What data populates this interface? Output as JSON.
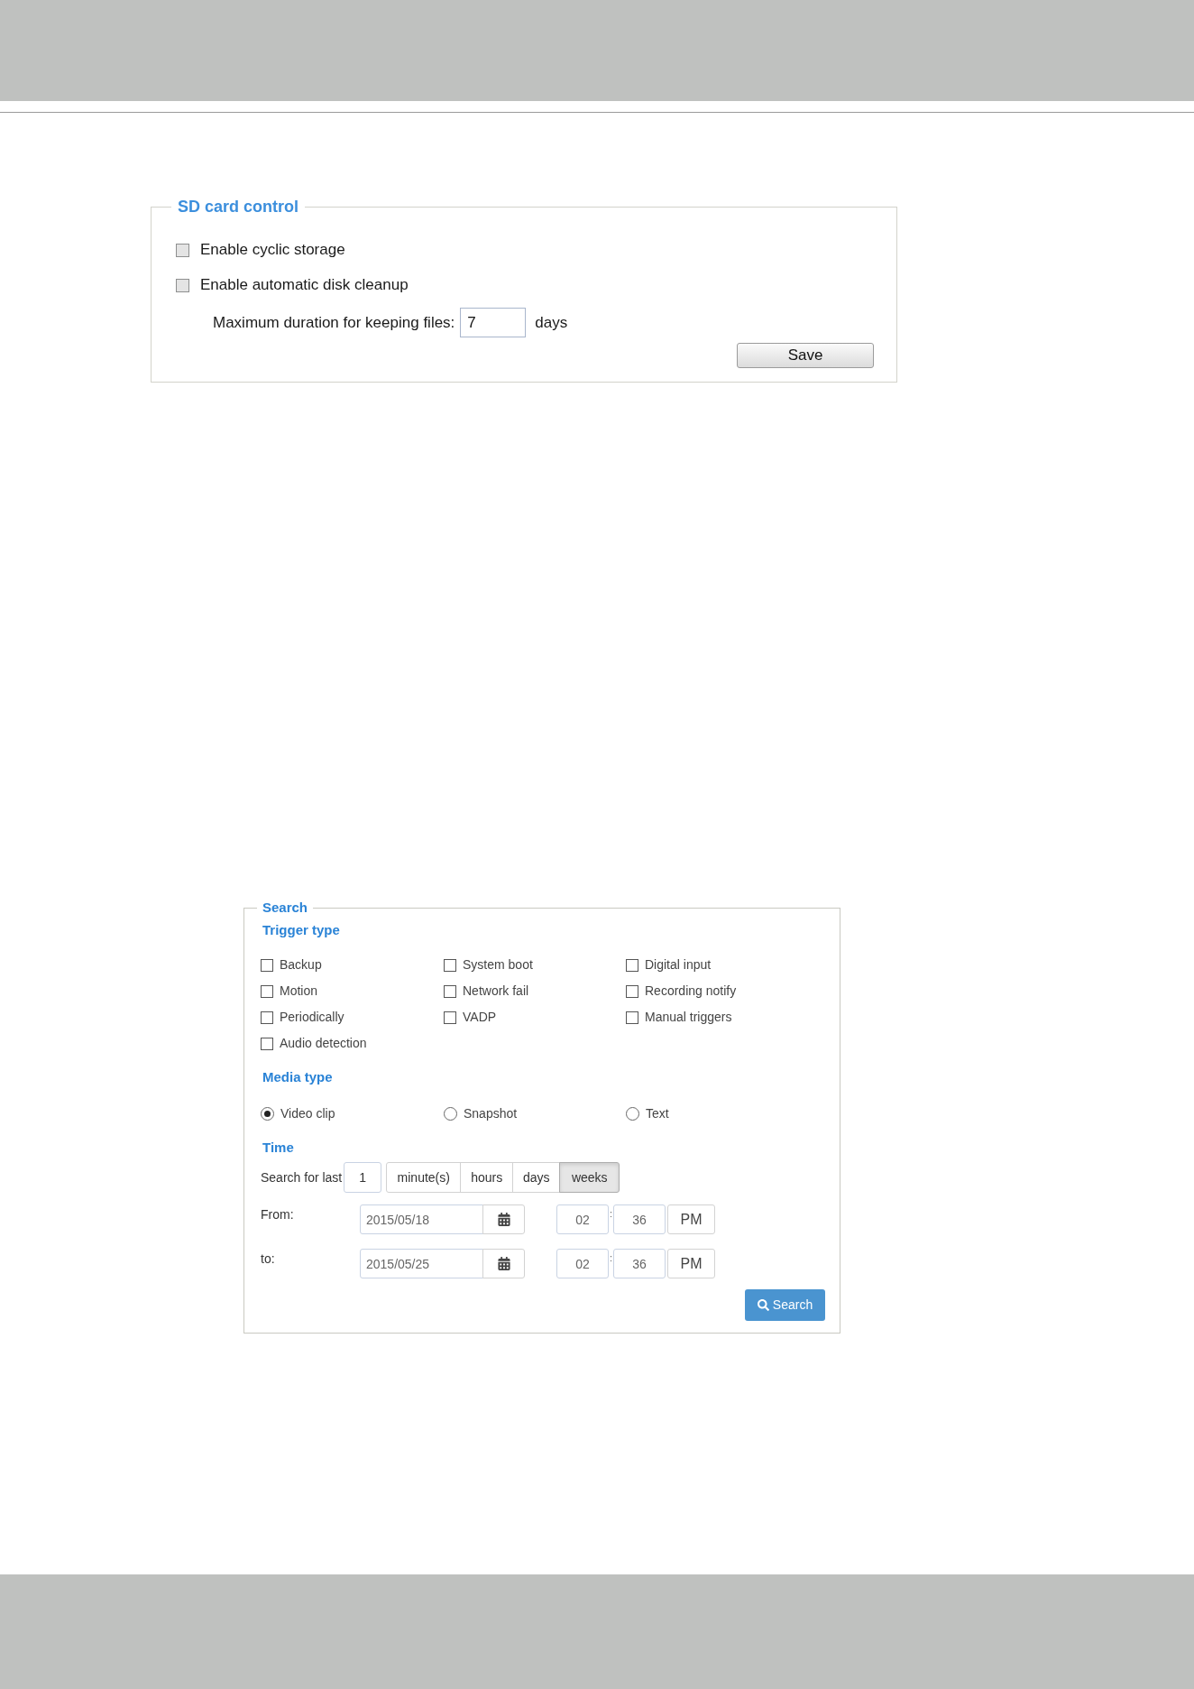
{
  "sd_card_control": {
    "title": "SD card control",
    "options": [
      {
        "label": "Enable cyclic storage",
        "checked": false
      },
      {
        "label": "Enable automatic disk cleanup",
        "checked": false
      }
    ],
    "max_duration": {
      "label": "Maximum duration for keeping files:",
      "value": "7",
      "unit": "days"
    },
    "save_button": "Save"
  },
  "search": {
    "title": "Search",
    "trigger_type": {
      "title": "Trigger type",
      "options": [
        {
          "label": "Backup",
          "checked": false
        },
        {
          "label": "System boot",
          "checked": false
        },
        {
          "label": "Digital input",
          "checked": false
        },
        {
          "label": "Motion",
          "checked": false
        },
        {
          "label": "Network fail",
          "checked": false
        },
        {
          "label": "Recording notify",
          "checked": false
        },
        {
          "label": "Periodically",
          "checked": false
        },
        {
          "label": "VADP",
          "checked": false
        },
        {
          "label": "Manual triggers",
          "checked": false
        },
        {
          "label": "Audio detection",
          "checked": false
        }
      ]
    },
    "media_type": {
      "title": "Media type",
      "options": [
        {
          "label": "Video clip",
          "selected": true
        },
        {
          "label": "Snapshot",
          "selected": false
        },
        {
          "label": "Text",
          "selected": false
        }
      ]
    },
    "time": {
      "title": "Time",
      "search_for_last": {
        "label": "Search for last",
        "value": "1",
        "units": [
          {
            "label": "minute(s)",
            "selected": false
          },
          {
            "label": "hours",
            "selected": false
          },
          {
            "label": "days",
            "selected": false
          },
          {
            "label": "weeks",
            "selected": true
          }
        ]
      },
      "ranges": [
        {
          "label": "From:",
          "date": "2015/05/18",
          "hour": "02",
          "separator": ":",
          "minute": "36",
          "period": "PM"
        },
        {
          "label": "to:",
          "date": "2015/05/25",
          "hour": "02",
          "separator": ":",
          "minute": "36",
          "period": "PM"
        }
      ]
    },
    "search_button": "Search"
  }
}
